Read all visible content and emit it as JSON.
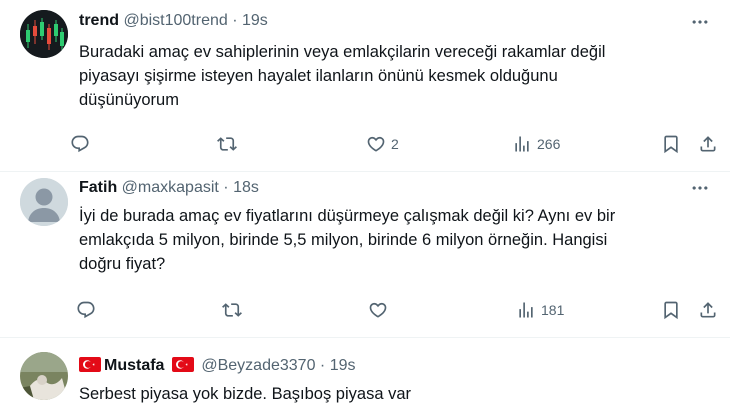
{
  "tweets": [
    {
      "name": "trend",
      "handle": "@bist100trend",
      "time": "19s",
      "lines": [
        "Buradaki amaç ev sahiplerinin veya emlakçilarin vereceği rakamlar değil",
        "piyasayı şişirme isteyen hayalet ilanların önünü kesmek olduğunu",
        "düşünüyorum"
      ],
      "likes": "2",
      "views": "266"
    },
    {
      "name": "Fatih",
      "handle": "@maxkapasit",
      "time": "18s",
      "lines": [
        "İyi de burada amaç ev fiyatlarını düşürmeye çalışmak değil ki? Aynı ev bir",
        "emlakçıda 5 milyon, birinde 5,5 milyon, birinde 6 milyon örneğin. Hangisi",
        "doğru fiyat?"
      ],
      "views": "181"
    },
    {
      "name": "Mustafa",
      "handle": "@Beyzade3370",
      "time": "19s",
      "lines": [
        "Serbest piyasa yok bizde. Başıboş piyasa var"
      ]
    }
  ],
  "dot": "·",
  "icons": [
    "reply-icon",
    "retweet-icon",
    "like-icon",
    "views-icon",
    "bookmark-icon",
    "share-icon",
    "more-icon",
    "turkey-flag-icon"
  ],
  "colors": {
    "text": "#0f1419",
    "secondary": "#536471",
    "divider": "#eff3f4",
    "flag": "#e30a17"
  }
}
